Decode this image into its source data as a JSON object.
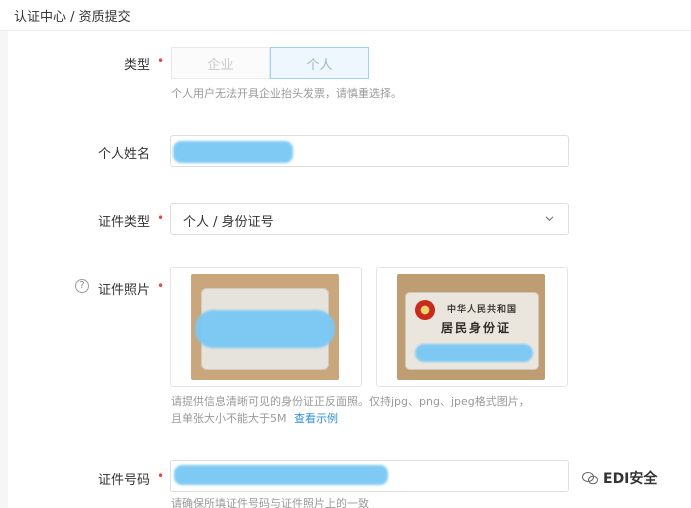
{
  "breadcrumb": "认证中心 / 资质提交",
  "form": {
    "type": {
      "label": "类型",
      "options": [
        "企业",
        "个人"
      ],
      "selected": "个人",
      "hint": "个人用户无法开具企业抬头发票，请慎重选择。"
    },
    "name": {
      "label": "个人姓名"
    },
    "doc_type": {
      "label": "证件类型",
      "value": "个人 / 身份证号"
    },
    "doc_photo": {
      "label": "证件照片",
      "card_back_line1": "中华人民共和国",
      "card_back_line2": "居民身份证",
      "hint_line1": "请提供信息清晰可见的身份证正反面照。仅持jpg、png、jpeg格式图片，",
      "hint_line2": "且单张大小不能大于5M",
      "example_link": "查看示例"
    },
    "doc_number": {
      "label": "证件号码",
      "hint": "请确保所填证件号码与证件照片上的一致"
    },
    "required_mark": "•"
  },
  "watermark": "EDI安全"
}
